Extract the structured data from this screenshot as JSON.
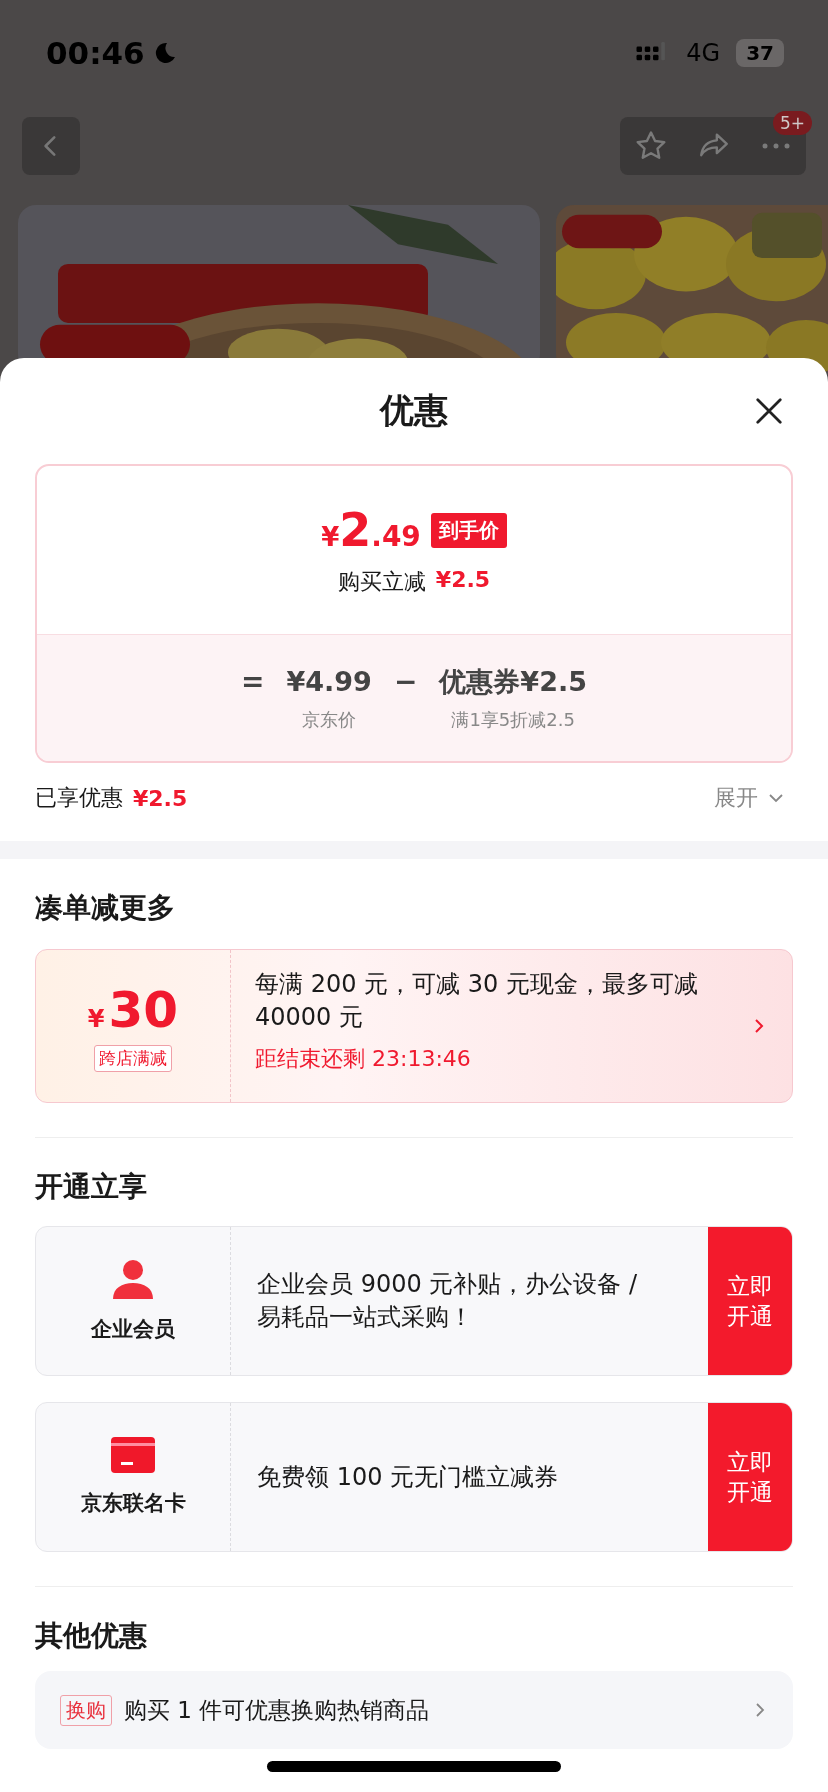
{
  "status_bar": {
    "time": "00:46",
    "network": "4G",
    "battery": "37"
  },
  "nav": {
    "badge": "5+"
  },
  "sheet": {
    "title": "优惠",
    "price_card": {
      "currency": "¥",
      "price_integer": "2",
      "price_decimal": ".49",
      "price_tag": "到手价",
      "instant_label": "购买立减",
      "instant_value": "¥2.5",
      "equals": "=",
      "base_price": "¥4.99",
      "base_label": "京东价",
      "minus": "−",
      "coupon": "优惠券¥2.5",
      "coupon_label": "满1享5折减2.5"
    },
    "enjoyed": {
      "label": "已享优惠",
      "value": "¥2.5",
      "expand": "展开"
    },
    "bundle_section": {
      "title": "凑单减更多",
      "currency": "¥",
      "amount": "30",
      "tag": "跨店满减",
      "description": "每满 200 元，可减 30 元现金，最多可减 40000 元",
      "countdown": "距结束还剩 23:13:46"
    },
    "membership_section": {
      "title": "开通立享",
      "offers": [
        {
          "kind": "member",
          "name": "企业会员",
          "description": "企业会员 9000 元补贴，办公设备 / 易耗品一站式采购！",
          "action": "立即开通"
        },
        {
          "kind": "card",
          "name": "京东联名卡",
          "description": "免费领 100 元无门槛立减券",
          "action": "立即开通"
        }
      ]
    },
    "other_section": {
      "title": "其他优惠",
      "items": [
        {
          "tag": "换购",
          "text": "购买 1 件可优惠换购热销商品"
        }
      ]
    }
  }
}
